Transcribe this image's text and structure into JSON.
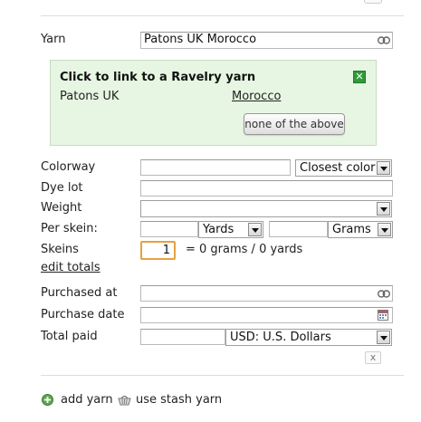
{
  "yarn": {
    "label": "Yarn",
    "value": "Patons UK Morocco"
  },
  "link_box": {
    "title": "Click to link to a Ravelry yarn",
    "brand": "Patons UK",
    "yarn_link": "Morocco",
    "none_button": "none of the above",
    "close_glyph": "✕"
  },
  "colorway": {
    "label": "Colorway",
    "value": "",
    "select": "Closest color"
  },
  "dye_lot": {
    "label": "Dye lot",
    "value": ""
  },
  "weight": {
    "label": "Weight",
    "select": ""
  },
  "per_skein": {
    "label": "Per skein:",
    "length_value": "",
    "length_unit": "Yards",
    "weight_value": "",
    "weight_unit": "Grams"
  },
  "skeins": {
    "label": "Skeins",
    "value": "1",
    "totals": "= 0 grams / 0 yards",
    "edit_link": "edit totals"
  },
  "purchased_at": {
    "label": "Purchased at",
    "value": ""
  },
  "purchase_date": {
    "label": "Purchase date",
    "value": ""
  },
  "total_paid": {
    "label": "Total paid",
    "value": "",
    "currency": "USD: U.S. Dollars"
  },
  "remove_glyph": "x",
  "footer": {
    "add_yarn": "add yarn",
    "use_stash": "use stash yarn"
  },
  "colors": {
    "accent_green": "#2f9a3a",
    "box_bg": "#e7f6e2",
    "focus_border": "#e8a040"
  }
}
